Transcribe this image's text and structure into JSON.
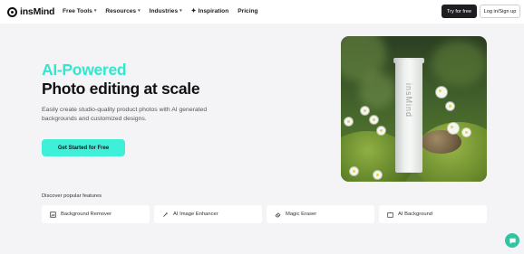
{
  "nav": {
    "logo_text": "insMind",
    "menu": [
      {
        "label": "Free Tools",
        "has_dropdown": true
      },
      {
        "label": "Resources",
        "has_dropdown": true
      },
      {
        "label": "Industries",
        "has_dropdown": true
      },
      {
        "label": "Inspiration",
        "has_dropdown": false,
        "icon": "sparkle-icon"
      },
      {
        "label": "Pricing",
        "has_dropdown": false
      }
    ],
    "try_label": "Try for free",
    "login_label": "Log in/Sign up"
  },
  "hero": {
    "title_accent": "AI-Powered",
    "title_main": "Photo editing at scale",
    "description": "Easily create studio-quality product photos with AI generated backgrounds and customized designs.",
    "cta_label": "Get Started for Free",
    "image_product_text": "insMind"
  },
  "features": {
    "label": "Discover popular features",
    "items": [
      {
        "label": "Background Remover",
        "icon": "image-crop-icon"
      },
      {
        "label": "AI Image Enhancer",
        "icon": "enhance-icon"
      },
      {
        "label": "Magic Eraser",
        "icon": "eraser-icon"
      },
      {
        "label": "AI Background",
        "icon": "ai-background-icon"
      }
    ]
  },
  "colors": {
    "accent": "#3ff0d8",
    "accent_text": "#33e6cf",
    "dark_button": "#1e1e22",
    "chat_button": "#2fc4a2",
    "page_bg": "#f4f4f6"
  }
}
